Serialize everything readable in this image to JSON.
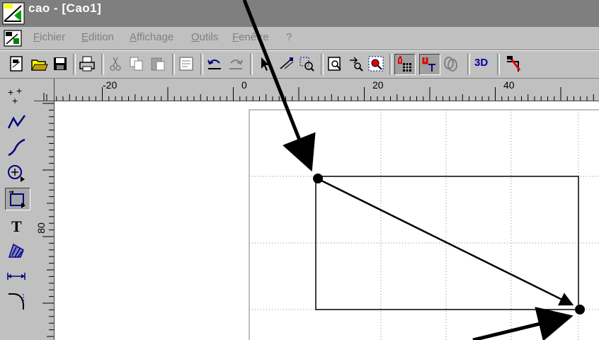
{
  "window": {
    "title": "cao - [Cao1]",
    "colors": {
      "face": "#c0c0c0",
      "titlebar_inactive": "#7f7f7f",
      "canvas": "#ffffff"
    }
  },
  "menu": {
    "items": [
      {
        "label": "Fichier",
        "icon": ""
      },
      {
        "label": "Edition"
      },
      {
        "label": "Affichage"
      },
      {
        "label": "Outils"
      },
      {
        "label": "Fenêtre"
      },
      {
        "label": "?"
      }
    ]
  },
  "toolbar": {
    "buttons": [
      "new-doc-icon",
      "open-folder-icon",
      "save-icon",
      "print-icon",
      "cut-icon",
      "copy-icon",
      "paste-icon",
      "properties-icon",
      "undo-icon",
      "redo-icon",
      "select-arrow-icon",
      "select-node-icon",
      "zoom-window-icon",
      "zoom-page-icon",
      "zoom-pan-icon",
      "zoom-all-icon",
      "magnet-grid-icon",
      "magnet-point-icon",
      "link-icon",
      "3d-view-button",
      "color-icon"
    ],
    "label_3d": "3D"
  },
  "left_tools": {
    "buttons": [
      "points-tool-icon",
      "polyline-tool-icon",
      "curve-tool-icon",
      "circle-tool-icon",
      "rectangle-tool-icon",
      "text-tool-icon",
      "hatch-tool-icon",
      "dimension-tool-icon",
      "fillet-tool-icon"
    ],
    "text_tool_label": "T",
    "active": "rectangle-tool-icon"
  },
  "rulers": {
    "horizontal_labels": [
      "-20",
      "0",
      "20",
      "40"
    ],
    "vertical_labels": [
      "80"
    ]
  }
}
